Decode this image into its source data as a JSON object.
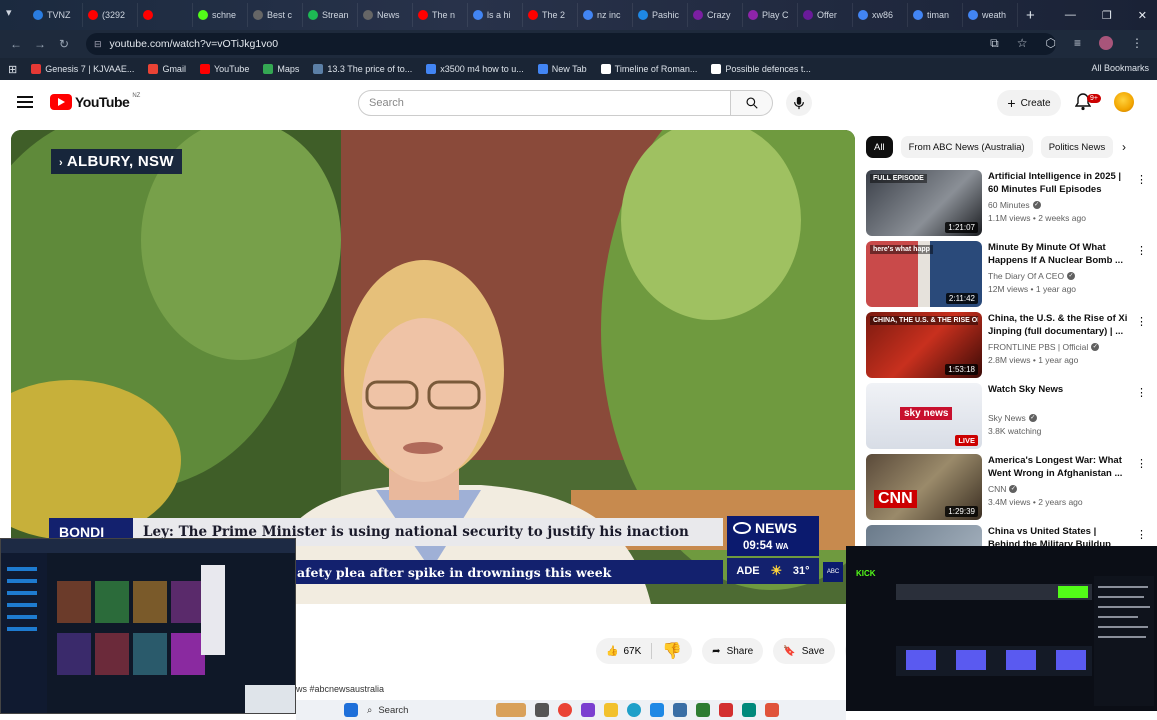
{
  "browser": {
    "tabs": [
      {
        "label": "TVNZ",
        "color": "#2a7de1"
      },
      {
        "label": "(3292",
        "color": "#ff0000"
      },
      {
        "label": "",
        "color": "#ff0000"
      },
      {
        "label": "schne",
        "color": "#53fc18"
      },
      {
        "label": "Best c",
        "color": "#666666"
      },
      {
        "label": "Strean",
        "color": "#1db954"
      },
      {
        "label": "News",
        "color": "#666666"
      },
      {
        "label": "The n",
        "color": "#ff0000"
      },
      {
        "label": "ls a hi",
        "color": "#4285f4"
      },
      {
        "label": "The 2",
        "color": "#ff0000"
      },
      {
        "label": "nz inc",
        "color": "#4285f4"
      },
      {
        "label": "Pashic",
        "color": "#1e88e5"
      },
      {
        "label": "Crazy",
        "color": "#7b1fa2"
      },
      {
        "label": "Play C",
        "color": "#8e24aa"
      },
      {
        "label": "Offer",
        "color": "#6a1b9a"
      },
      {
        "label": "xw86",
        "color": "#4285f4"
      },
      {
        "label": "timan",
        "color": "#4285f4"
      },
      {
        "label": "weath",
        "color": "#4285f4"
      }
    ],
    "new_tab": "+",
    "window_controls": [
      "—",
      "❐",
      "✕"
    ],
    "url": "youtube.com/watch?v=vOTiJkg1vo0",
    "bookmarks": [
      {
        "label": "Genesis 7 | KJVAAE...",
        "color": "#e53935"
      },
      {
        "label": "Gmail",
        "color": "#ea4335"
      },
      {
        "label": "YouTube",
        "color": "#ff0000"
      },
      {
        "label": "Maps",
        "color": "#34a853"
      },
      {
        "label": "13.3 The price of to...",
        "color": "#5b7fa6"
      },
      {
        "label": "x3500 m4 how to u...",
        "color": "#4285f4"
      },
      {
        "label": "New Tab",
        "color": "#4285f4"
      },
      {
        "label": "Timeline of Roman...",
        "color": "#ffffff"
      },
      {
        "label": "Possible defences t...",
        "color": "#ffffff"
      }
    ],
    "all_bookmarks": "All Bookmarks"
  },
  "youtube": {
    "logo_text": "YouTube",
    "logo_region": "NZ",
    "search_placeholder": "Search",
    "create_label": "Create",
    "notification_count": "9+"
  },
  "video": {
    "location": "ALBURY, NSW",
    "ticker_tag": "BONDI",
    "ticker_headline": "Ley: The Prime Minister is using national security to justify his inaction",
    "ticker_sub": "afety plea after spike in drownings this week",
    "channel_bug": "NEWS",
    "clock": "09:54",
    "timezone": "WA",
    "weather_city": "ADE",
    "temperature": "31°"
  },
  "actions": {
    "likes": "67K",
    "share": "Share",
    "save": "Save",
    "more": "···"
  },
  "hashtags": "ws #abcnewsaustralia",
  "chips": [
    "All",
    "From ABC News (Australia)",
    "Politics News"
  ],
  "related": [
    {
      "title": "Artificial Intelligence in 2025 | 60 Minutes Full Episodes",
      "channel": "60 Minutes",
      "meta": "1.1M views • 2 weeks ago",
      "duration": "1:21:07",
      "badge": "FULL EPISODE",
      "theme": "a"
    },
    {
      "title": "Minute By Minute Of What Happens If A Nuclear Bomb ...",
      "channel": "The Diary Of A CEO",
      "meta": "12M views • 1 year ago",
      "duration": "2:11:42",
      "badge": "here's what happ",
      "theme": "b"
    },
    {
      "title": "China, the U.S. & the Rise of Xi Jinping (full documentary) | ...",
      "channel": "FRONTLINE PBS | Official",
      "meta": "2.8M views • 1 year ago",
      "duration": "1:53:18",
      "badge": "CHINA, THE U.S. & THE RISE OF XI JINPING",
      "theme": "c"
    },
    {
      "title": "Watch Sky News",
      "channel": "Sky News",
      "meta": "3.8K watching",
      "duration": "LIVE",
      "badge": "sky news",
      "theme": "d"
    },
    {
      "title": "America's Longest War: What Went Wrong in Afghanistan ...",
      "channel": "CNN",
      "meta": "3.4M views • 2 years ago",
      "duration": "1:29:39",
      "badge": "CNN",
      "theme": "e"
    },
    {
      "title": "China vs United States | Behind the Military Buildup",
      "channel": "",
      "meta": "",
      "duration": "",
      "badge": "",
      "theme": "f"
    }
  ],
  "taskbar": {
    "search": "Search"
  }
}
